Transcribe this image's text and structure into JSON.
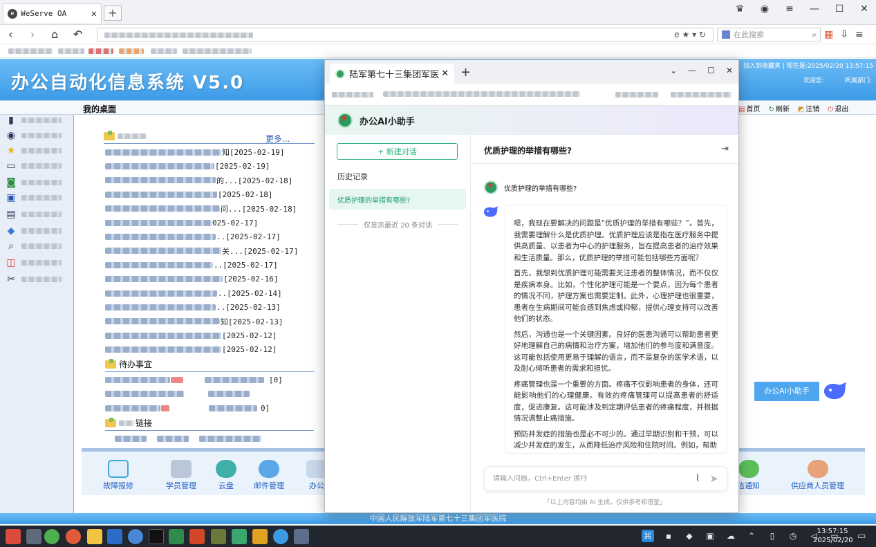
{
  "outer_browser": {
    "tab_title": "WeServe OA",
    "search_placeholder": "在此搜索"
  },
  "oa": {
    "system_title": "办公自动化信息系统 V5.0",
    "top_links": "加入到收藏夹 | 现在是:2025/02/20 13:57:15",
    "welcome_label": "欢迎您:",
    "department_label": "所属部门:",
    "toolbar": {
      "home": "首页",
      "refresh": "刷新",
      "logout_switch": "注销",
      "exit": "退出"
    },
    "desk_title": "我的桌面",
    "more_link": "更多...",
    "news_dates": [
      "知[2025-02-19]",
      "[2025-02-19]",
      "的...[2025-02-18]",
      "[2025-02-18]",
      "问...[2025-02-18]",
      "025-02-17]",
      "..[2025-02-17]",
      "关...[2025-02-17]",
      "..[2025-02-17]",
      "[2025-02-16]",
      "..[2025-02-14]",
      "..[2025-02-13]",
      "知[2025-02-13]",
      "[2025-02-12]",
      "[2025-02-12]"
    ],
    "pending_title": "待办事宜",
    "pending_counts": [
      "[0]",
      "0]"
    ],
    "links_title": "链接",
    "bottom_items": [
      "故障报修",
      "学员管理",
      "云盘",
      "邮件管理",
      "办公",
      "信通知",
      "供应商人员管理"
    ],
    "footer": "中国人民解放军陆军第七十三集团军医院",
    "floating_assistant": "办公AI小助手"
  },
  "popup": {
    "tab_title": "陆军第七十三集团军医",
    "app_title": "办公AI小助手",
    "new_chat": "+ 新建对话",
    "history_label": "历史记录",
    "history_items": [
      "优质护理的举措有哪些?"
    ],
    "history_note": "仅显示最近 20 条对话",
    "conversation_title": "优质护理的举措有哪些?",
    "user_question": "优质护理的举措有哪些?",
    "answer_paragraphs": [
      "嗯，我现在要解决的问题是“优质护理的举措有哪些？”。首先，我需要理解什么是优质护理。优质护理应该是指在医疗服务中提供高质量、以患者为中心的护理服务，旨在提高患者的治疗效果和生活质量。那么，优质护理的举措可能包括哪些方面呢？",
      "首先，我想到优质护理可能需要关注患者的整体情况，而不仅仅是疾病本身。比如，个性化护理可能是一个要点，因为每个患者的情况不同，护理方案也需要定制。此外，心理护理也很重要，患者在生病期间可能会感到焦虑或抑郁，提供心理支持可以改善他们的状态。",
      "然后，沟通也是一个关键因素。良好的医患沟通可以帮助患者更好地理解自己的病情和治疗方案，增加他们的参与度和满意度。这可能包括使用更易于理解的语言，而不是复杂的医学术语，以及耐心倾听患者的需求和担忧。",
      "疼痛管理也是一个重要的方面。疼痛不仅影响患者的身体，还可能影响他们的心理健康。有效的疼痛管理可以提高患者的舒适度，促进康复。这可能涉及到定期评估患者的疼痛程度，并根据情况调整止痛措施。",
      "预防并发症的措施也是必不可少的。通过早期识别和干预，可以减少并发症的发生，从而降低治疗风险和住院时间。例如，帮助"
    ],
    "input_placeholder": "请输入问题，Ctrl+Enter 换行",
    "disclaimer": "「以上内容均由 AI 生成，仅供参考和借鉴」"
  },
  "taskbar": {
    "time": "13:57:15",
    "date": "2025/02/20"
  },
  "colors": {
    "oa_blue": "#3d9be8",
    "accent_green": "#2fb07a",
    "link_blue": "#1f5fc2"
  }
}
